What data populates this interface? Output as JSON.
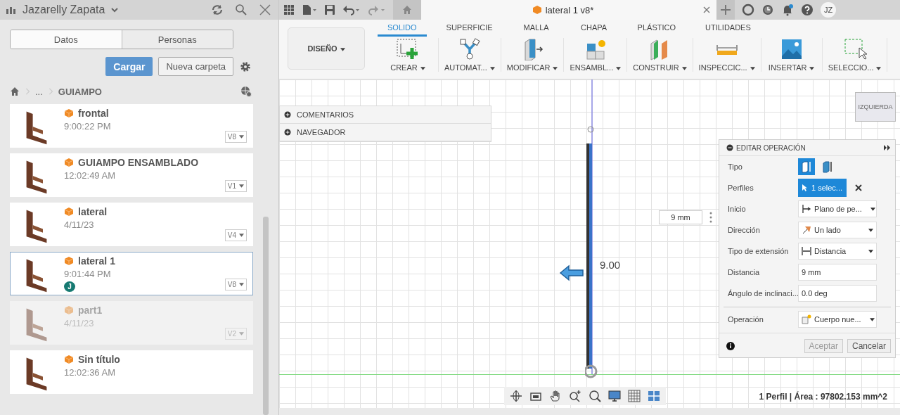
{
  "data_panel": {
    "user": "Jazarelly Zapata",
    "tabs": [
      {
        "label": "Datos",
        "selected": true
      },
      {
        "label": "Personas",
        "selected": false
      }
    ],
    "upload_button": "Cargar",
    "new_folder_button": "Nueva carpeta",
    "breadcrumb": [
      "...",
      "GUIAMPO"
    ],
    "files": [
      {
        "name": "frontal",
        "date": "9:00:22 PM",
        "version": "V8",
        "selected": false,
        "disabled": false
      },
      {
        "name": "GUIAMPO ENSAMBLADO",
        "date": "12:02:49 AM",
        "version": "V1",
        "selected": false,
        "disabled": false
      },
      {
        "name": "lateral",
        "date": "4/11/23",
        "version": "V4",
        "selected": false,
        "disabled": false
      },
      {
        "name": "lateral 1",
        "date": "9:01:44 PM",
        "version": "V8",
        "selected": true,
        "disabled": false,
        "user_badge": "J"
      },
      {
        "name": "part1",
        "date": "4/11/23",
        "version": "V2",
        "selected": false,
        "disabled": true
      },
      {
        "name": "Sin título",
        "date": "12:02:36 AM",
        "selected": false,
        "disabled": false
      }
    ]
  },
  "document_tab": {
    "title": "lateral 1 v8*"
  },
  "user_avatar": "JZ",
  "ribbon": {
    "workspace": "DISEÑO",
    "tabs": [
      {
        "label": "SOLIDO",
        "selected": true
      },
      {
        "label": "SUPERFICIE",
        "selected": false
      },
      {
        "label": "MALLA",
        "selected": false
      },
      {
        "label": "CHAPA",
        "selected": false
      },
      {
        "label": "PLÁSTICO",
        "selected": false
      },
      {
        "label": "UTILIDADES",
        "selected": false
      }
    ],
    "tools": [
      {
        "label": "CREAR",
        "kind": "create"
      },
      {
        "label": "AUTOMAT...",
        "kind": "automate"
      },
      {
        "label": "MODIFICAR",
        "kind": "modify"
      },
      {
        "label": "ENSAMBL...",
        "kind": "assemble"
      },
      {
        "label": "CONSTRUIR",
        "kind": "construct"
      },
      {
        "label": "INSPECCIC...",
        "kind": "inspect"
      },
      {
        "label": "INSERTAR",
        "kind": "insert"
      },
      {
        "label": "SELECCIO...",
        "kind": "select"
      }
    ]
  },
  "browser_panel": [
    "COMENTARIOS",
    "NAVEGADOR"
  ],
  "view_cube": "IZQUIERDA",
  "canvas_dimension": "9.00",
  "distance_popup": "9 mm",
  "dialog": {
    "title": "EDITAR OPERACIÓN",
    "rows": [
      {
        "kind": "toggle",
        "label": "Tipo",
        "options": [
          {
            "selected": true
          },
          {
            "selected": false
          }
        ]
      },
      {
        "kind": "selection",
        "label": "Perfiles",
        "value": "1 selec..."
      },
      {
        "kind": "dropdown",
        "label": "Inicio",
        "value": "Plano de pe..."
      },
      {
        "kind": "dropdown",
        "label": "Dirección",
        "value": "Un lado"
      },
      {
        "kind": "dropdown",
        "label": "Tipo de extensión",
        "value": "Distancia"
      },
      {
        "kind": "input",
        "label": "Distancia",
        "value": "9 mm"
      },
      {
        "kind": "input",
        "label": "Ángulo de inclinaci...",
        "value": "0.0 deg"
      },
      {
        "kind": "dropdown",
        "label": "Operación",
        "value": "Cuerpo nue...",
        "separated": true
      }
    ],
    "ok_button": "Aceptar",
    "cancel_button": "Cancelar"
  },
  "status": "1 Perfil | Área : 97802.153 mm^2"
}
